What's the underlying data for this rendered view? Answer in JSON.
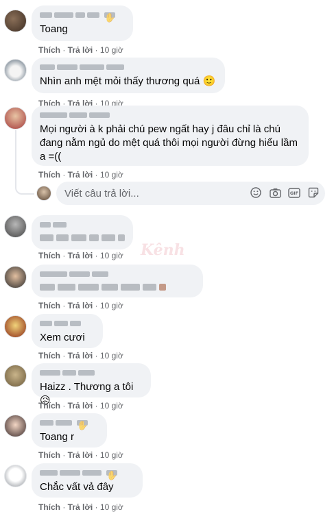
{
  "comments": [
    {
      "text": "Toang",
      "actions": {
        "like": "Thích",
        "reply": "Trả lời",
        "time": "10 giờ"
      }
    },
    {
      "text": "Nhìn anh mệt mỏi thấy thương quá",
      "emoji": "🙂",
      "actions": {
        "like": "Thích",
        "reply": "Trả lời",
        "time": "10 giờ"
      }
    },
    {
      "text": "Mọi người à k phải chú pew ngất hay j đâu chỉ là chú\nđang nằm ngủ do mệt quá thôi mọi người đừng hiểu lầm\na =((",
      "actions": {
        "like": "Thích",
        "reply": "Trả lời",
        "time": "10 giờ"
      }
    },
    {
      "text": "",
      "actions": {
        "like": "Thích",
        "reply": "Trả lời",
        "time": "10 giờ"
      }
    },
    {
      "text": "",
      "actions": {
        "like": "Thích",
        "reply": "Trả lời",
        "time": "10 giờ"
      }
    },
    {
      "text": "Xem cươi",
      "actions": {
        "like": "Thích",
        "reply": "Trả lời",
        "time": "10 giờ"
      }
    },
    {
      "text": "Haizz . Thương a tôi",
      "emoji": "😥",
      "actions": {
        "like": "Thích",
        "reply": "Trả lời",
        "time": "10 giờ"
      }
    },
    {
      "text": "Toang r",
      "actions": {
        "like": "Thích",
        "reply": "Trả lời",
        "time": "10 giờ"
      }
    },
    {
      "text": "Chắc vất vả đây",
      "actions": {
        "like": "Thích",
        "reply": "Trả lời",
        "time": "10 giờ"
      }
    }
  ],
  "reply_box": {
    "placeholder": "Viết câu trả lời...",
    "icons": [
      "smiley-icon",
      "camera-icon",
      "gif-icon",
      "sticker-icon"
    ]
  },
  "colors": {
    "bubble": "#f0f2f5",
    "meta": "#65676b",
    "text": "#050505"
  }
}
